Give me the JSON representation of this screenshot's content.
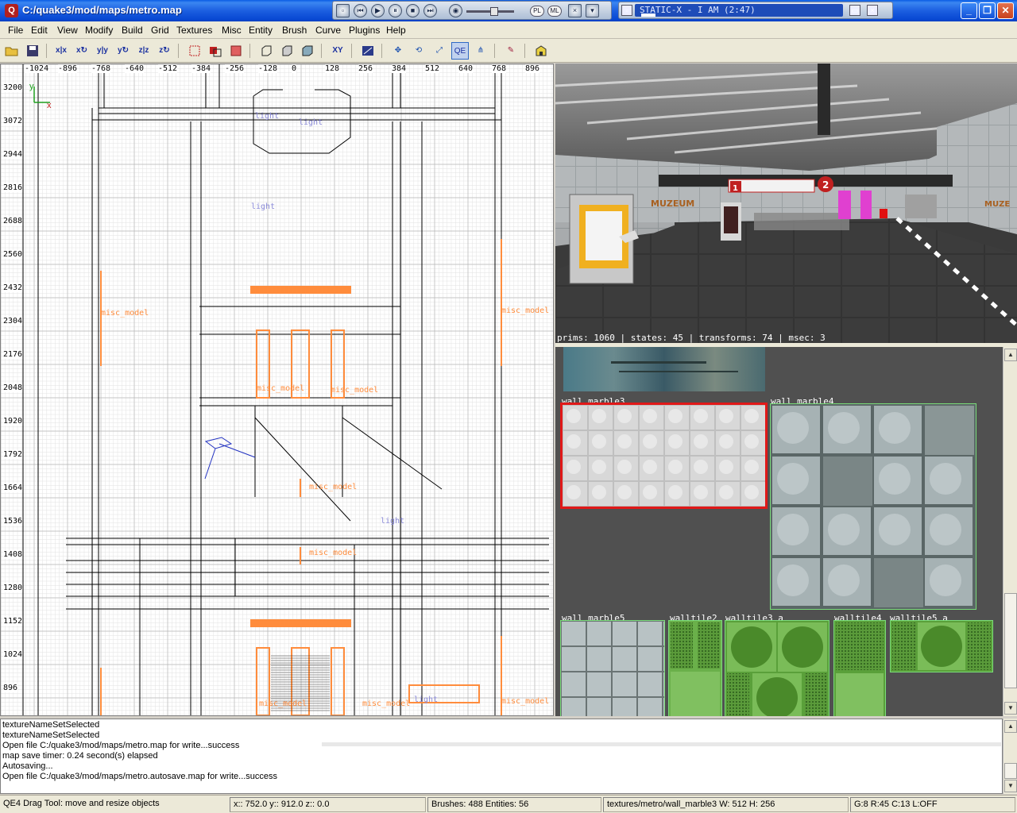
{
  "window": {
    "title": "C:/quake3/mod/maps/metro.map",
    "app_icon": "Q"
  },
  "media": {
    "btn_minimize": "▫",
    "btn_prev": "⏮",
    "btn_play": "▶",
    "btn_pause": "⏸",
    "btn_stop": "■",
    "btn_next": "⏭",
    "btn_mute": "◉",
    "pill_pl": "PL",
    "pill_ml": "ML",
    "now_playing": "STATIC-X - I AM (2:47)"
  },
  "menu": [
    "File",
    "Edit",
    "View",
    "Modify",
    "Build",
    "Grid",
    "Textures",
    "Misc",
    "Entity",
    "Brush",
    "Curve",
    "Plugins",
    "Help"
  ],
  "toolbar": {
    "buttons": [
      "open-icon",
      "save-icon",
      "flip-x-icon",
      "rotate-x-icon",
      "flip-y-icon",
      "rotate-y-icon",
      "flip-z-icon",
      "rotate-z-icon",
      "select-complete-icon",
      "select-inside-icon",
      "select-touching-icon",
      "csg-hollow-icon",
      "csg-subtract-icon",
      "csg-merge-icon",
      "view-change-icon",
      "texture-lock-icon",
      "drag-edges-icon",
      "drag-vertices-icon",
      "scale-icon",
      "qe4-drag-icon",
      "clipper-icon",
      "patch-icon",
      "plugin-icon"
    ],
    "labels": {
      "xy": "XY",
      "qe": "QE"
    }
  },
  "view2d": {
    "x_ticks": [
      "-1024",
      "-896",
      "-768",
      "-640",
      "-512",
      "-384",
      "-256",
      "-128",
      "0",
      "128",
      "256",
      "384",
      "512",
      "640",
      "768",
      "896"
    ],
    "y_ticks": [
      "3200",
      "3072",
      "2944",
      "2816",
      "2688",
      "2560",
      "2432",
      "2304",
      "2176",
      "2048",
      "1920",
      "1792",
      "1664",
      "1536",
      "1408",
      "1280",
      "1152",
      "1024",
      "896"
    ],
    "axis_x": "x",
    "axis_y": "y",
    "entities": [
      "misc_model",
      "misc_model",
      "misc_model",
      "misc_model",
      "misc_model",
      "misc_model",
      "misc_model",
      "misc_model",
      "misc_model",
      "light",
      "light",
      "light",
      "light",
      "light"
    ],
    "colors": {
      "grid_fine": "#e2e2e2",
      "grid_major": "#b8b8b8",
      "brush": "#000000",
      "model": "#ff8c3c",
      "light": "#8a8ad8"
    }
  },
  "view3d": {
    "stats": "prims: 1060 | states: 45 | transforms: 74 | msec: 3",
    "signs": {
      "left_sign": "MUZEUM",
      "right_sign": "MUZE",
      "num1": "2",
      "num2": "1"
    }
  },
  "textures": [
    {
      "name": "wall_marble3",
      "selected": true
    },
    {
      "name": "wall_marble4",
      "selected": false
    },
    {
      "name": "wall_marble5",
      "selected": false
    },
    {
      "name": "walltile2",
      "selected": false
    },
    {
      "name": "walltile3_a",
      "selected": false
    },
    {
      "name": "walltile4",
      "selected": false
    },
    {
      "name": "walltile5_a",
      "selected": false
    }
  ],
  "console": [
    "textureNameSetSelected",
    "textureNameSetSelected",
    "Open file C:/quake3/mod/maps/metro.map for write...success",
    "map save timer:  0.24 second(s) elapsed",
    "Autosaving...",
    "Open file C:/quake3/mod/maps/metro.autosave.map for write...success"
  ],
  "status": {
    "tool": "QE4 Drag Tool: move and resize objects",
    "coords": "x::  752.0  y::  912.0  z::    0.0",
    "counts": "Brushes: 488 Entities: 56",
    "texture": "textures/metro/wall_marble3 W: 512 H: 256",
    "grid": "G:8  R:45  C:13  L:OFF"
  }
}
